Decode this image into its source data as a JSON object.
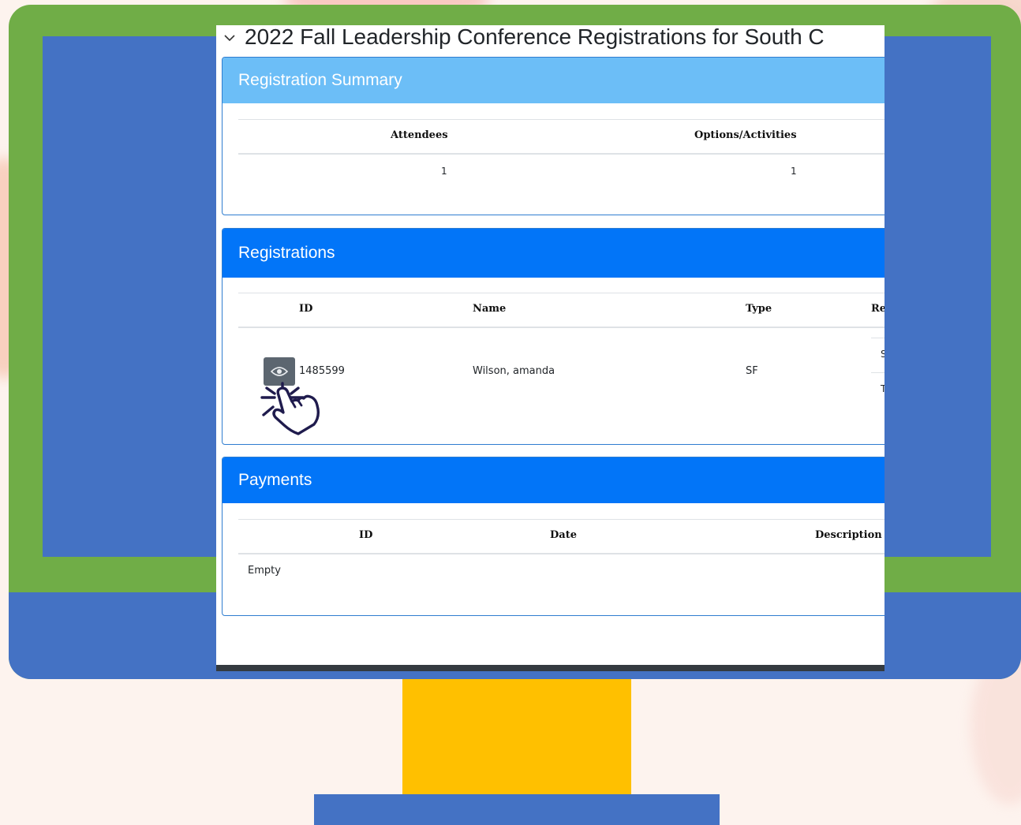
{
  "page_title": "2022 Fall Leadership Conference Registrations for South C",
  "summary": {
    "heading": "Registration Summary",
    "columns": [
      "Attendees",
      "Options/Activities"
    ],
    "values": [
      "1",
      "1"
    ]
  },
  "registrations": {
    "heading": "Registrations",
    "columns": [
      "ID",
      "Name",
      "Type",
      "Re"
    ],
    "rows": [
      {
        "id": "1485599",
        "name": "Wilson, amanda",
        "type": "SF",
        "cut1": "S",
        "cut2": "T"
      }
    ]
  },
  "payments": {
    "heading": "Payments",
    "columns": [
      "ID",
      "Date",
      "Description"
    ],
    "empty_text": "Empty"
  },
  "colors": {
    "monitor_green": "#70ad47",
    "monitor_blue": "#4472c4",
    "stand_yellow": "#ffc000",
    "header_light_blue": "#6cbef7",
    "header_blue": "#0275f8"
  },
  "icons": {
    "view": "eye-icon",
    "cursor": "click-hand-icon",
    "collapse": "chevron-down-icon"
  }
}
